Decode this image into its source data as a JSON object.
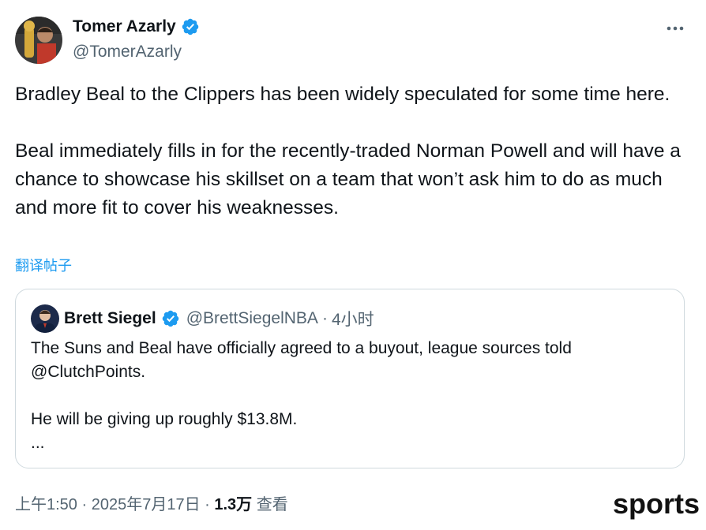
{
  "tweet": {
    "author": {
      "name": "Tomer Azarly",
      "handle": "@TomerAzarly",
      "verified": true
    },
    "text": "Bradley Beal to the Clippers has been widely speculated for some time here.\n\nBeal immediately fills in for the recently-traded Norman Powell and will have a chance to showcase his skillset on a team that won’t ask him to do as much and more fit to cover his weaknesses.",
    "translate_label": "翻译帖子",
    "more_icon": "more-horizontal-icon"
  },
  "quote": {
    "author": {
      "name": "Brett Siegel",
      "handle": "@BrettSiegelNBA",
      "verified": true
    },
    "separator": "·",
    "time": "4小时",
    "text": "The Suns and Beal have officially agreed to a buyout, league sources told @ClutchPoints.\n\nHe will be giving up roughly $13.8M.\n..."
  },
  "meta": {
    "time": "上午1:50",
    "sep1": " · ",
    "date": "2025年7月17日",
    "sep2": " · ",
    "views_count": "1.3万",
    "views_label": " 查看"
  },
  "watermark": "sports",
  "colors": {
    "accent": "#1d9bf0",
    "secondary_text": "#536471",
    "border": "#cfd9de"
  }
}
